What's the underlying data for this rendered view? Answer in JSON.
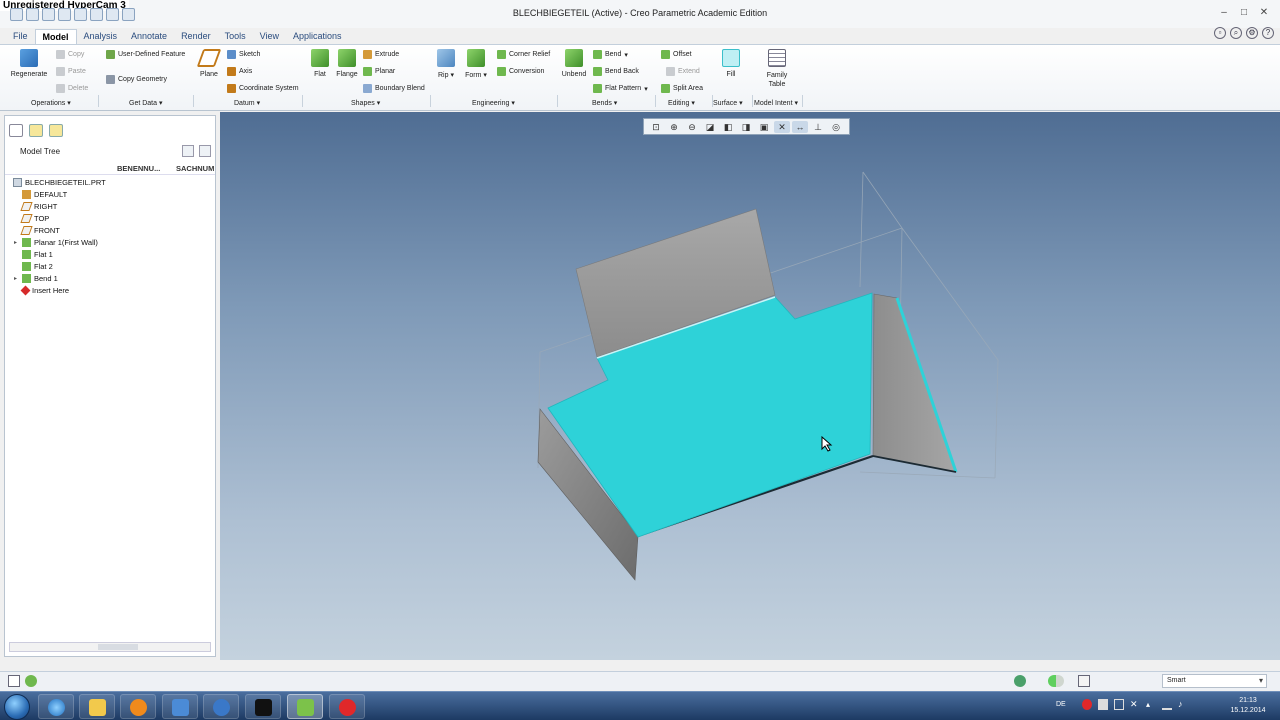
{
  "overlay": {
    "watermark": "Unregistered HyperCam 3"
  },
  "window": {
    "title": "BLECHBIEGETEIL (Active) - Creo Parametric Academic Edition",
    "controls": [
      "–",
      "□",
      "✕"
    ]
  },
  "tabs": [
    "File",
    "Model",
    "Analysis",
    "Annotate",
    "Render",
    "Tools",
    "View",
    "Applications"
  ],
  "active_tab": "Model",
  "ribbon": {
    "regenerate": "Regenerate",
    "copy": "Copy",
    "paste": "Paste",
    "delete": "Delete",
    "user_defined_feature": "User-Defined Feature",
    "copy_geometry": "Copy Geometry",
    "plane": "Plane",
    "sketch": "Sketch",
    "axis": "Axis",
    "coordinate_system": "Coordinate System",
    "flat": "Flat",
    "flange": "Flange",
    "extrude": "Extrude",
    "planar": "Planar",
    "boundary_blend": "Boundary Blend",
    "rip": "Rip",
    "form": "Form",
    "corner_relief": "Corner Relief",
    "conversion": "Conversion",
    "unbend": "Unbend",
    "bend": "Bend",
    "bend_back": "Bend Back",
    "flat_pattern": "Flat Pattern",
    "offset": "Offset",
    "extend": "Extend",
    "split_area": "Split Area",
    "fill": "Fill",
    "family_table": "Family\nTable",
    "groups": [
      "Operations",
      "Get Data",
      "Datum",
      "Shapes",
      "Engineering",
      "Bends",
      "Editing",
      "Surface",
      "Model Intent"
    ]
  },
  "model_tree": {
    "title": "Model Tree",
    "columns": [
      "BENENNU...",
      "SACHNUM"
    ],
    "items": [
      {
        "label": "BLECHBIEGETEIL.PRT",
        "icon": "part-icon",
        "expander": ""
      },
      {
        "label": "DEFAULT",
        "icon": "csys-icon",
        "expander": ""
      },
      {
        "label": "RIGHT",
        "icon": "datum-plane-icon",
        "expander": ""
      },
      {
        "label": "TOP",
        "icon": "datum-plane-icon",
        "expander": ""
      },
      {
        "label": "FRONT",
        "icon": "datum-plane-icon",
        "expander": ""
      },
      {
        "label": "Planar 1(First Wall)",
        "icon": "sheetmetal-wall-icon",
        "expander": "▸"
      },
      {
        "label": "Flat 1",
        "icon": "sheetmetal-wall-icon",
        "expander": ""
      },
      {
        "label": "Flat 2",
        "icon": "sheetmetal-wall-icon",
        "expander": ""
      },
      {
        "label": "Bend 1",
        "icon": "bend-icon",
        "expander": "▸"
      },
      {
        "label": "Insert Here",
        "icon": "insert-here-icon",
        "expander": ""
      }
    ]
  },
  "statusbar": {
    "selection_filter": "Smart"
  },
  "taskbar": {
    "language": "DE",
    "time": "21:13",
    "date": "15.12.2014"
  },
  "colors": {
    "selection_highlight": "#2ed2d8",
    "sheet_gray": "#9a9a9a",
    "viewport_top": "#4f6d93",
    "viewport_bottom": "#c4d2de"
  }
}
